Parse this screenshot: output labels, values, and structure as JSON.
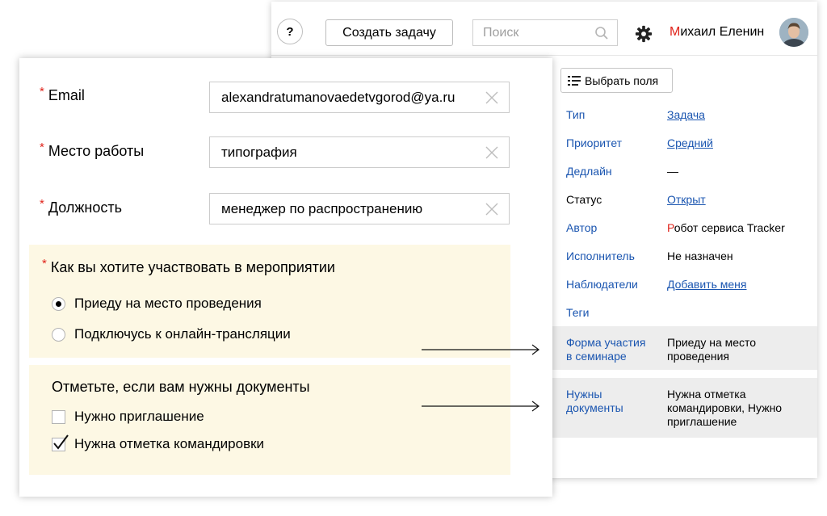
{
  "header": {
    "help_label": "?",
    "create_task_label": "Создать задачу",
    "search_placeholder": "Поиск",
    "user_first_letter": "М",
    "user_name_rest": "ихаил Еленин"
  },
  "sidebar": {
    "select_fields_label": "Выбрать поля",
    "properties": [
      {
        "key": "Тип",
        "value": "Задача"
      },
      {
        "key": "Приоритет",
        "value": "Средний"
      },
      {
        "key": "Дедлайн",
        "value": "—"
      },
      {
        "key": "Статус",
        "value": "Открыт"
      },
      {
        "key": "Автор",
        "value_first_letter": "Р",
        "value_rest": "обот сервиса Tracker"
      },
      {
        "key": "Исполнитель",
        "value": "Не назначен"
      },
      {
        "key": "Наблюдатели",
        "value": "Добавить меня"
      },
      {
        "key": "Теги",
        "value": ""
      },
      {
        "key": "Форма участия в семинаре",
        "value": "Приеду на место проведения"
      },
      {
        "key": "Нужны документы",
        "value": "Нужна отметка командировки, Нужно приглашение"
      }
    ]
  },
  "form": {
    "required_mark": "*",
    "fields": [
      {
        "label": "Email",
        "value": "alexandratumanovaedetvgorod@ya.ru"
      },
      {
        "label": "Место работы",
        "value": "типография"
      },
      {
        "label": "Должность",
        "value": "менеджер по распространению"
      }
    ],
    "participation": {
      "question": "Как вы хотите участвовать в мероприятии",
      "options": [
        {
          "label": "Приеду на место проведения",
          "selected": true
        },
        {
          "label": "Подключусь к онлайн-трансляции",
          "selected": false
        }
      ]
    },
    "documents": {
      "question": "Отметьте, если вам нужны документы",
      "options": [
        {
          "label": "Нужно приглашение",
          "checked": false
        },
        {
          "label": "Нужна отметка командировки",
          "checked": true
        }
      ]
    }
  },
  "colors": {
    "accent_red": "#e0241b",
    "link_blue": "#1a55b0",
    "section_bg": "#fdf8e4",
    "shaded_row": "#ededed"
  }
}
